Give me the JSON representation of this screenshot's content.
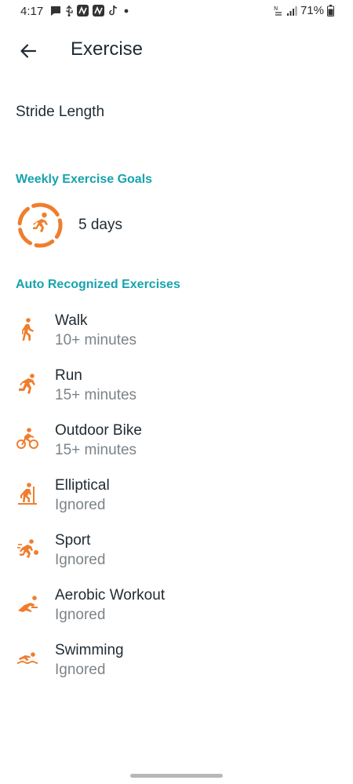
{
  "status_bar": {
    "time": "4:17",
    "battery": "71%",
    "icons": [
      "message-icon",
      "usb-icon",
      "fitbit-n-icon",
      "fitbit-n-icon",
      "tiktok-icon",
      "dot-icon",
      "nfc-icon",
      "signal-icon",
      "battery-icon"
    ]
  },
  "header": {
    "back_icon": "arrow-left-icon",
    "title": "Exercise"
  },
  "stride": {
    "label": "Stride Length"
  },
  "weekly_goals": {
    "section_title": "Weekly Exercise Goals",
    "value": "5 days",
    "icon": "runner-ring-icon"
  },
  "auto_recognized": {
    "section_title": "Auto Recognized Exercises",
    "items": [
      {
        "name": "Walk",
        "detail": "10+ minutes",
        "icon": "walk-icon"
      },
      {
        "name": "Run",
        "detail": "15+ minutes",
        "icon": "run-icon"
      },
      {
        "name": "Outdoor Bike",
        "detail": "15+ minutes",
        "icon": "bike-icon"
      },
      {
        "name": "Elliptical",
        "detail": "Ignored",
        "icon": "elliptical-icon"
      },
      {
        "name": "Sport",
        "detail": "Ignored",
        "icon": "sport-icon"
      },
      {
        "name": "Aerobic Workout",
        "detail": "Ignored",
        "icon": "aerobic-icon"
      },
      {
        "name": "Swimming",
        "detail": "Ignored",
        "icon": "swim-icon"
      }
    ]
  },
  "colors": {
    "accent_teal": "#17a3ad",
    "icon_orange": "#f07d2e",
    "text_primary": "#1f2a33",
    "text_secondary": "#7c8388"
  }
}
